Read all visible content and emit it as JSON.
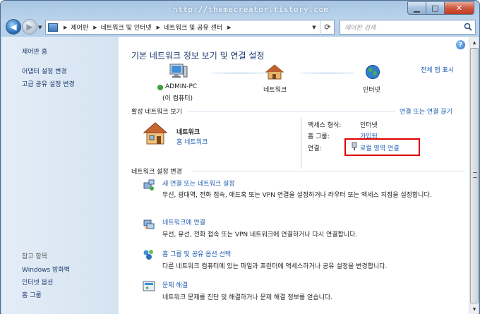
{
  "window": {
    "watermark": "http://themecreator.tistory.com",
    "caption_buttons": {
      "minimize": "▁",
      "maximize": "□",
      "close": "✕"
    }
  },
  "nav": {
    "back_icon": "back-arrow-icon",
    "forward_icon": "forward-arrow-icon",
    "breadcrumbs": [
      "제어판",
      "네트워크 및 인터넷",
      "네트워크 및 공유 센터"
    ],
    "search_placeholder": "제어판 검색"
  },
  "sidebar": {
    "links": [
      "제어판 홈",
      "어댑터 설정 변경",
      "고급 공유 설정 변경"
    ],
    "see_also_label": "참고 항목",
    "see_also": [
      "Windows 방화벽",
      "인터넷 옵션",
      "홈 그룹"
    ]
  },
  "main": {
    "title": "기본 네트워크 정보 보기 및 연결 설정",
    "full_map_link": "전체 맵 표시",
    "map": {
      "computer_name": "ADMIN-PC",
      "computer_sub": "(이 컴퓨터)",
      "network_label": "네트워크",
      "internet_label": "인터넷"
    },
    "active_header": "활성 네트워크 보기",
    "connect_disconnect_link": "연결 또는 연결 끊기",
    "active_network": {
      "name": "네트워크",
      "type_link": "홈 네트워크",
      "access_type_key": "액세스 형식:",
      "access_type_val": "인터넷",
      "homegroup_key": "홈 그룹:",
      "homegroup_val": "가입됨",
      "connection_key": "연결:",
      "connection_val": "로컬 영역 연결"
    },
    "settings_header": "네트워크 설정 변경",
    "tasks": [
      {
        "title": "새 연결 또는 네트워크 설정",
        "desc": "무선, 광대역, 전화 접속, 애드혹 또는 VPN 연결을 설정하거나 라우터 또는 액세스 지점을 설정합니다."
      },
      {
        "title": "네트워크에 연결",
        "desc": "무선, 유선, 전화 접속 또는 VPN 네트워크에 연결하거나 다시 연결합니다."
      },
      {
        "title": "홈 그룹 및 공유 옵션 선택",
        "desc": "다른 네트워크 컴퓨터에 있는 파일과 프린터에 액세스하거나 공유 설정을 변경합니다."
      },
      {
        "title": "문제 해결",
        "desc": "네트워크 문제를 진단 및 해결하거나 문제 해결 정보를 얻습니다."
      }
    ]
  },
  "colors": {
    "link": "#1f5fb2",
    "highlight_box": "#e00000",
    "sidebar_bg": "#dce8f4"
  }
}
